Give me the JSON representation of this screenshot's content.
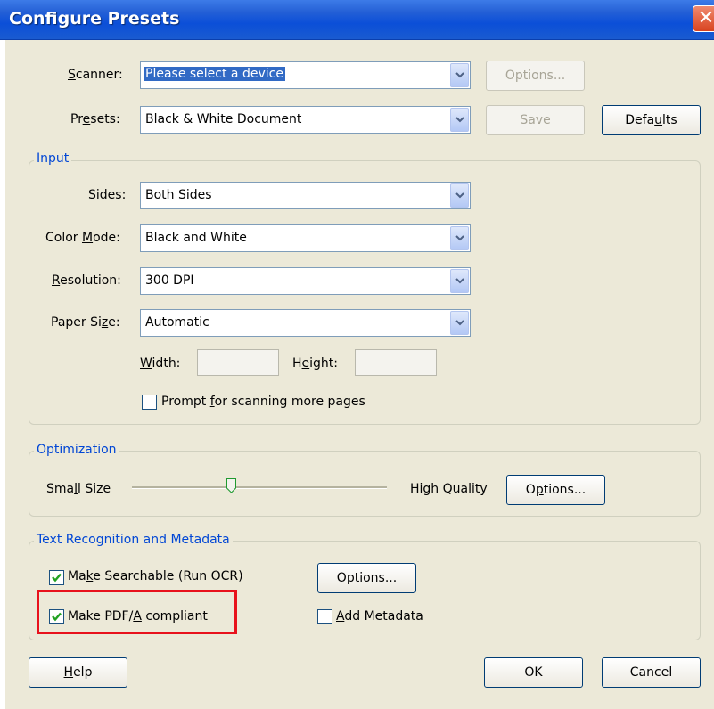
{
  "window": {
    "title": "Configure Presets",
    "close_glyph": "✕"
  },
  "scanner": {
    "label_pre": "",
    "label_ul": "S",
    "label_post": "canner:",
    "value": "Please select a device",
    "options_button": "Options..."
  },
  "presets": {
    "label_pre": "Pr",
    "label_ul": "e",
    "label_post": "sets:",
    "value": "Black & White Document",
    "save_button": "Save",
    "defaults_pre": "Defa",
    "defaults_ul": "u",
    "defaults_post": "lts"
  },
  "input": {
    "group_title": "Input",
    "sides": {
      "label_pre": "S",
      "label_ul": "i",
      "label_post": "des:",
      "value": "Both Sides"
    },
    "color_mode": {
      "label_pre": "Color ",
      "label_ul": "M",
      "label_post": "ode:",
      "value": "Black and White"
    },
    "resolution": {
      "label_pre": "",
      "label_ul": "R",
      "label_post": "esolution:",
      "value": "300 DPI"
    },
    "paper_size": {
      "label_pre": "Paper Si",
      "label_ul": "z",
      "label_post": "e:",
      "value": "Automatic"
    },
    "width": {
      "label_pre": "",
      "label_ul": "W",
      "label_post": "idth:",
      "value": ""
    },
    "height": {
      "label_pre": "H",
      "label_ul": "e",
      "label_post": "ight:",
      "value": ""
    },
    "prompt": {
      "label_pre": "Prompt ",
      "label_ul": "f",
      "label_post": "or scanning more pages",
      "checked": false
    }
  },
  "optimization": {
    "group_title": "Optimization",
    "small_pre": "Sma",
    "small_ul": "l",
    "small_post": "l Size",
    "high_label": "High Quality",
    "slider_level": 0.39,
    "options_pre": "O",
    "options_ul": "p",
    "options_post": "tions..."
  },
  "ocr": {
    "group_title": "Text Recognition and Metadata",
    "searchable": {
      "label_pre": "Ma",
      "label_ul": "k",
      "label_post": "e Searchable (Run OCR)",
      "checked": true
    },
    "options_pre": "Opt",
    "options_ul": "i",
    "options_post": "ons...",
    "pdfa": {
      "label_pre": "Make PDF/",
      "label_ul": "A",
      "label_post": " compliant",
      "checked": true
    },
    "metadata": {
      "label_pre": "",
      "label_ul": "A",
      "label_post": "dd Metadata",
      "checked": false
    }
  },
  "footer": {
    "help_pre": "",
    "help_ul": "H",
    "help_post": "elp",
    "ok": "OK",
    "cancel": "Cancel"
  },
  "highlight_color": "#e8121c"
}
